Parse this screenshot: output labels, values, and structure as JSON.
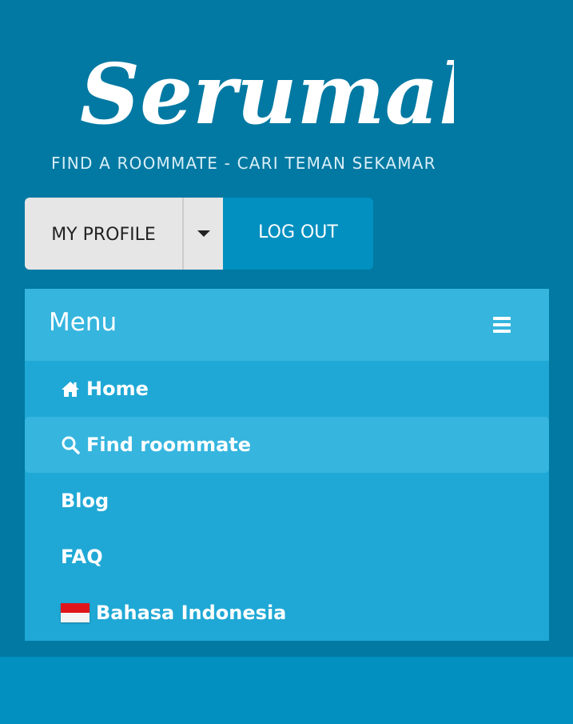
{
  "brand": {
    "name": "Serumah",
    "tagline": "FIND A ROOMMATE - CARI TEMAN SEKAMAR"
  },
  "auth": {
    "profile_label": "MY PROFILE",
    "logout_label": "LOG OUT"
  },
  "menu": {
    "title": "Menu",
    "items": [
      {
        "label": "Home",
        "icon": "home-icon"
      },
      {
        "label": "Find roommate",
        "icon": "search-icon",
        "active": true
      },
      {
        "label": "Blog"
      },
      {
        "label": "FAQ"
      },
      {
        "label": "Bahasa Indonesia",
        "icon": "indonesia-flag-icon"
      }
    ]
  },
  "colors": {
    "header_bg": "#0179a2",
    "page_bg": "#0190c0",
    "menu_bg": "#1fa8d5",
    "menu_active_bg": "#36b5de",
    "button_light": "#e6e6e6"
  }
}
